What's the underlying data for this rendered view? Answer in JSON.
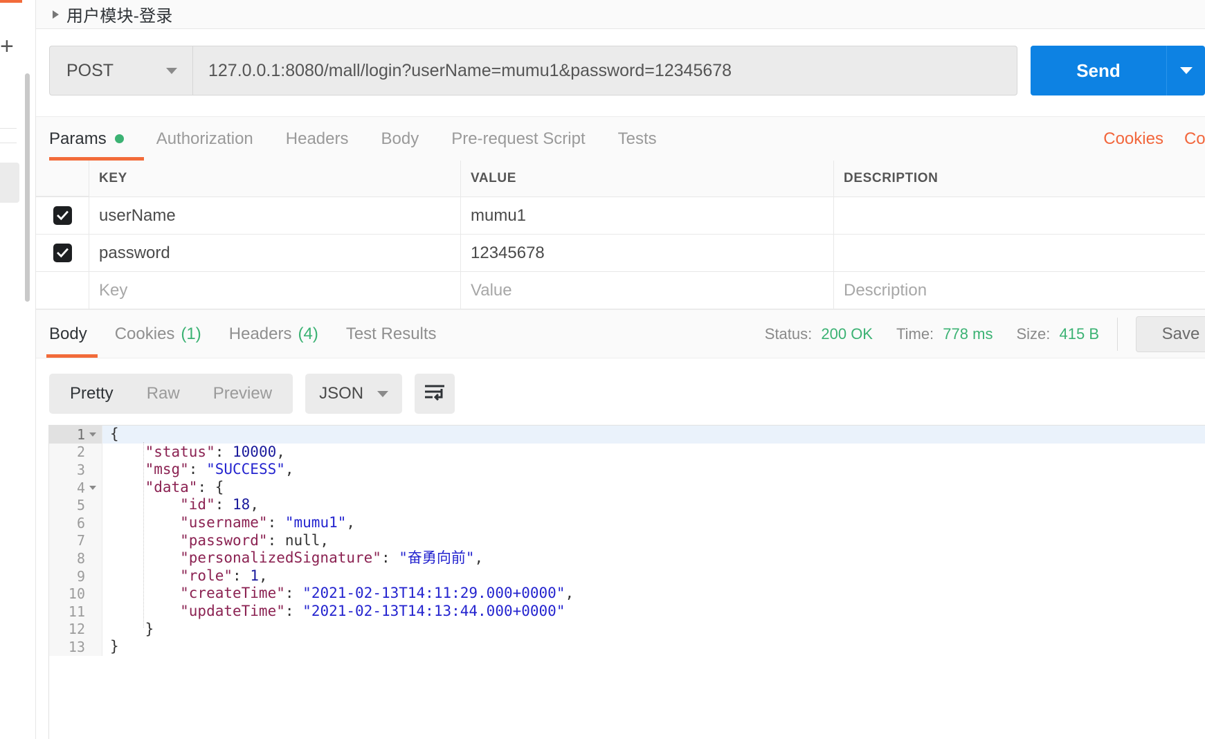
{
  "breadcrumb": {
    "label": "用户模块-登录",
    "caret_icon": "triangle-right-icon"
  },
  "request": {
    "method": "POST",
    "url": "127.0.0.1:8080/mall/login?userName=mumu1&password=12345678",
    "send_label": "Send",
    "send_caret_icon": "chevron-down-icon",
    "method_caret_icon": "chevron-down-icon"
  },
  "request_tabs": [
    {
      "label": "Params",
      "active": true,
      "has_dot": true
    },
    {
      "label": "Authorization",
      "active": false,
      "has_dot": false
    },
    {
      "label": "Headers",
      "active": false,
      "has_dot": false
    },
    {
      "label": "Body",
      "active": false,
      "has_dot": false
    },
    {
      "label": "Pre-request Script",
      "active": false,
      "has_dot": false
    },
    {
      "label": "Tests",
      "active": false,
      "has_dot": false
    }
  ],
  "request_tabs_right": [
    {
      "label": "Cookies"
    },
    {
      "label": "Cod"
    }
  ],
  "params_table": {
    "headers": {
      "key": "KEY",
      "value": "VALUE",
      "description": "DESCRIPTION"
    },
    "rows": [
      {
        "checked": true,
        "key": "userName",
        "value": "mumu1",
        "description": ""
      },
      {
        "checked": true,
        "key": "password",
        "value": "12345678",
        "description": ""
      }
    ],
    "placeholder_row": {
      "checked": false,
      "key": "Key",
      "value": "Value",
      "description": "Description"
    }
  },
  "response_tabs": [
    {
      "label": "Body",
      "count": "",
      "active": true
    },
    {
      "label": "Cookies",
      "count": "(1)",
      "active": false
    },
    {
      "label": "Headers",
      "count": "(4)",
      "active": false
    },
    {
      "label": "Test Results",
      "count": "",
      "active": false
    }
  ],
  "response_meta": {
    "status_label": "Status:",
    "status_value": "200 OK",
    "time_label": "Time:",
    "time_value": "778 ms",
    "size_label": "Size:",
    "size_value": "415 B",
    "save_label": "Save"
  },
  "format_bar": {
    "modes": [
      {
        "label": "Pretty",
        "active": true
      },
      {
        "label": "Raw",
        "active": false
      },
      {
        "label": "Preview",
        "active": false
      }
    ],
    "language": "JSON",
    "language_caret_icon": "chevron-down-icon",
    "wrap_icon": "word-wrap-icon"
  },
  "code_viewer": {
    "lines": [
      {
        "num": "1",
        "foldable": true,
        "tokens": [
          {
            "t": "{",
            "c": "p"
          }
        ]
      },
      {
        "num": "2",
        "foldable": false,
        "tokens": [
          {
            "t": "    \"status\"",
            "c": "k"
          },
          {
            "t": ": ",
            "c": "p"
          },
          {
            "t": "10000",
            "c": "n"
          },
          {
            "t": ",",
            "c": "p"
          }
        ]
      },
      {
        "num": "3",
        "foldable": false,
        "tokens": [
          {
            "t": "    \"msg\"",
            "c": "k"
          },
          {
            "t": ": ",
            "c": "p"
          },
          {
            "t": "\"SUCCESS\"",
            "c": "s"
          },
          {
            "t": ",",
            "c": "p"
          }
        ]
      },
      {
        "num": "4",
        "foldable": true,
        "tokens": [
          {
            "t": "    \"data\"",
            "c": "k"
          },
          {
            "t": ": {",
            "c": "p"
          }
        ]
      },
      {
        "num": "5",
        "foldable": false,
        "tokens": [
          {
            "t": "        \"id\"",
            "c": "k"
          },
          {
            "t": ": ",
            "c": "p"
          },
          {
            "t": "18",
            "c": "n"
          },
          {
            "t": ",",
            "c": "p"
          }
        ]
      },
      {
        "num": "6",
        "foldable": false,
        "tokens": [
          {
            "t": "        \"username\"",
            "c": "k"
          },
          {
            "t": ": ",
            "c": "p"
          },
          {
            "t": "\"mumu1\"",
            "c": "s"
          },
          {
            "t": ",",
            "c": "p"
          }
        ]
      },
      {
        "num": "7",
        "foldable": false,
        "tokens": [
          {
            "t": "        \"password\"",
            "c": "k"
          },
          {
            "t": ": null,",
            "c": "p"
          }
        ]
      },
      {
        "num": "8",
        "foldable": false,
        "tokens": [
          {
            "t": "        \"personalizedSignature\"",
            "c": "k"
          },
          {
            "t": ": ",
            "c": "p"
          },
          {
            "t": "\"奋勇向前\"",
            "c": "s"
          },
          {
            "t": ",",
            "c": "p"
          }
        ]
      },
      {
        "num": "9",
        "foldable": false,
        "tokens": [
          {
            "t": "        \"role\"",
            "c": "k"
          },
          {
            "t": ": ",
            "c": "p"
          },
          {
            "t": "1",
            "c": "n"
          },
          {
            "t": ",",
            "c": "p"
          }
        ]
      },
      {
        "num": "10",
        "foldable": false,
        "tokens": [
          {
            "t": "        \"createTime\"",
            "c": "k"
          },
          {
            "t": ": ",
            "c": "p"
          },
          {
            "t": "\"2021-02-13T14:11:29.000+0000\"",
            "c": "s"
          },
          {
            "t": ",",
            "c": "p"
          }
        ]
      },
      {
        "num": "11",
        "foldable": false,
        "tokens": [
          {
            "t": "        \"updateTime\"",
            "c": "k"
          },
          {
            "t": ": ",
            "c": "p"
          },
          {
            "t": "\"2021-02-13T14:13:44.000+0000\"",
            "c": "s"
          }
        ]
      },
      {
        "num": "12",
        "foldable": false,
        "tokens": [
          {
            "t": "    }",
            "c": "p"
          }
        ]
      },
      {
        "num": "13",
        "foldable": false,
        "tokens": [
          {
            "t": "}",
            "c": "p"
          }
        ]
      }
    ]
  },
  "colors": {
    "accent_orange": "#f26b3a",
    "send_blue": "#0d82e3",
    "success_green": "#3bb273",
    "json_key": "#8b2252",
    "json_string": "#2424cf",
    "json_number": "#1a1a9c"
  }
}
